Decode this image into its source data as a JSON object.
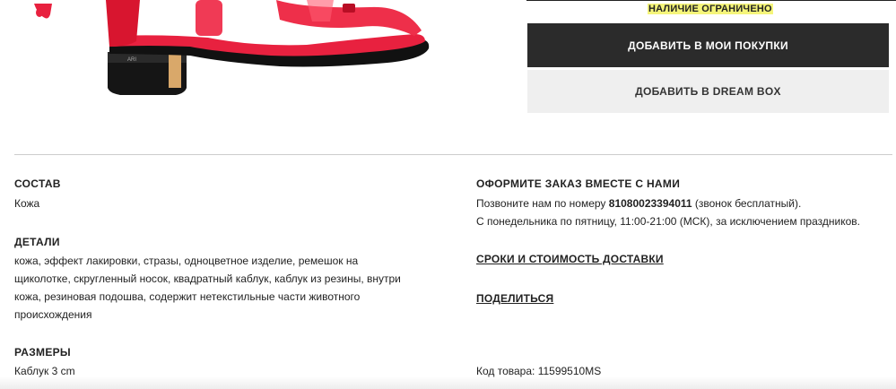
{
  "product": {
    "availability": "НАЛИЧИЕ ОГРАНИЧЕНО",
    "add_to_cart": "ДОБАВИТЬ В МОИ ПОКУПКИ",
    "add_to_dreambox": "ДОБАВИТЬ В DREAM BOX",
    "image_colors": {
      "strap": "#e8213f",
      "heel": "#151515",
      "heel_band": "#d9a86a"
    }
  },
  "composition": {
    "heading": "СОСТАВ",
    "value": "Кожа"
  },
  "details": {
    "heading": "ДЕТАЛИ",
    "lines": [
      "кожа, эффект лакировки, стразы, одноцветное изделие, ремешок на",
      "щиколотке, скругленный носок, квадратный каблук, каблук из резины, внутри",
      "кожа, резиновая подошва, содержит нетекстильные части животного",
      "происхождения"
    ]
  },
  "sizes": {
    "heading": "РАЗМЕРЫ",
    "value": "Каблук 3 cm"
  },
  "order": {
    "heading": "ОФОРМИТЕ ЗАКАЗ ВМЕСТЕ С НАМИ",
    "phone_prefix": "Позвоните нам по номеру ",
    "phone": "81080023394011",
    "phone_suffix": " (звонок бесплатный).",
    "hours": "С понедельника по пятницу, 11:00-21:00 (МСК), за исключением праздников."
  },
  "links": {
    "delivery": "СРОКИ И СТОИМОСТЬ ДОСТАВКИ",
    "share": "ПОДЕЛИТЬСЯ"
  },
  "sku": "Код товара: 11599510MS"
}
